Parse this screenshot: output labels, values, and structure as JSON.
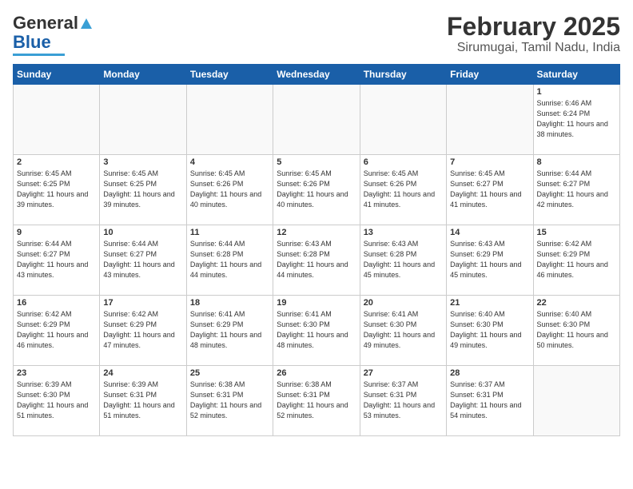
{
  "header": {
    "logo_line1": "General",
    "logo_line2": "Blue",
    "title": "February 2025",
    "subtitle": "Sirumugai, Tamil Nadu, India"
  },
  "weekdays": [
    "Sunday",
    "Monday",
    "Tuesday",
    "Wednesday",
    "Thursday",
    "Friday",
    "Saturday"
  ],
  "weeks": [
    [
      {
        "day": "",
        "info": ""
      },
      {
        "day": "",
        "info": ""
      },
      {
        "day": "",
        "info": ""
      },
      {
        "day": "",
        "info": ""
      },
      {
        "day": "",
        "info": ""
      },
      {
        "day": "",
        "info": ""
      },
      {
        "day": "1",
        "info": "Sunrise: 6:46 AM\nSunset: 6:24 PM\nDaylight: 11 hours\nand 38 minutes."
      }
    ],
    [
      {
        "day": "2",
        "info": "Sunrise: 6:45 AM\nSunset: 6:25 PM\nDaylight: 11 hours\nand 39 minutes."
      },
      {
        "day": "3",
        "info": "Sunrise: 6:45 AM\nSunset: 6:25 PM\nDaylight: 11 hours\nand 39 minutes."
      },
      {
        "day": "4",
        "info": "Sunrise: 6:45 AM\nSunset: 6:26 PM\nDaylight: 11 hours\nand 40 minutes."
      },
      {
        "day": "5",
        "info": "Sunrise: 6:45 AM\nSunset: 6:26 PM\nDaylight: 11 hours\nand 40 minutes."
      },
      {
        "day": "6",
        "info": "Sunrise: 6:45 AM\nSunset: 6:26 PM\nDaylight: 11 hours\nand 41 minutes."
      },
      {
        "day": "7",
        "info": "Sunrise: 6:45 AM\nSunset: 6:27 PM\nDaylight: 11 hours\nand 41 minutes."
      },
      {
        "day": "8",
        "info": "Sunrise: 6:44 AM\nSunset: 6:27 PM\nDaylight: 11 hours\nand 42 minutes."
      }
    ],
    [
      {
        "day": "9",
        "info": "Sunrise: 6:44 AM\nSunset: 6:27 PM\nDaylight: 11 hours\nand 43 minutes."
      },
      {
        "day": "10",
        "info": "Sunrise: 6:44 AM\nSunset: 6:27 PM\nDaylight: 11 hours\nand 43 minutes."
      },
      {
        "day": "11",
        "info": "Sunrise: 6:44 AM\nSunset: 6:28 PM\nDaylight: 11 hours\nand 44 minutes."
      },
      {
        "day": "12",
        "info": "Sunrise: 6:43 AM\nSunset: 6:28 PM\nDaylight: 11 hours\nand 44 minutes."
      },
      {
        "day": "13",
        "info": "Sunrise: 6:43 AM\nSunset: 6:28 PM\nDaylight: 11 hours\nand 45 minutes."
      },
      {
        "day": "14",
        "info": "Sunrise: 6:43 AM\nSunset: 6:29 PM\nDaylight: 11 hours\nand 45 minutes."
      },
      {
        "day": "15",
        "info": "Sunrise: 6:42 AM\nSunset: 6:29 PM\nDaylight: 11 hours\nand 46 minutes."
      }
    ],
    [
      {
        "day": "16",
        "info": "Sunrise: 6:42 AM\nSunset: 6:29 PM\nDaylight: 11 hours\nand 46 minutes."
      },
      {
        "day": "17",
        "info": "Sunrise: 6:42 AM\nSunset: 6:29 PM\nDaylight: 11 hours\nand 47 minutes."
      },
      {
        "day": "18",
        "info": "Sunrise: 6:41 AM\nSunset: 6:29 PM\nDaylight: 11 hours\nand 48 minutes."
      },
      {
        "day": "19",
        "info": "Sunrise: 6:41 AM\nSunset: 6:30 PM\nDaylight: 11 hours\nand 48 minutes."
      },
      {
        "day": "20",
        "info": "Sunrise: 6:41 AM\nSunset: 6:30 PM\nDaylight: 11 hours\nand 49 minutes."
      },
      {
        "day": "21",
        "info": "Sunrise: 6:40 AM\nSunset: 6:30 PM\nDaylight: 11 hours\nand 49 minutes."
      },
      {
        "day": "22",
        "info": "Sunrise: 6:40 AM\nSunset: 6:30 PM\nDaylight: 11 hours\nand 50 minutes."
      }
    ],
    [
      {
        "day": "23",
        "info": "Sunrise: 6:39 AM\nSunset: 6:30 PM\nDaylight: 11 hours\nand 51 minutes."
      },
      {
        "day": "24",
        "info": "Sunrise: 6:39 AM\nSunset: 6:31 PM\nDaylight: 11 hours\nand 51 minutes."
      },
      {
        "day": "25",
        "info": "Sunrise: 6:38 AM\nSunset: 6:31 PM\nDaylight: 11 hours\nand 52 minutes."
      },
      {
        "day": "26",
        "info": "Sunrise: 6:38 AM\nSunset: 6:31 PM\nDaylight: 11 hours\nand 52 minutes."
      },
      {
        "day": "27",
        "info": "Sunrise: 6:37 AM\nSunset: 6:31 PM\nDaylight: 11 hours\nand 53 minutes."
      },
      {
        "day": "28",
        "info": "Sunrise: 6:37 AM\nSunset: 6:31 PM\nDaylight: 11 hours\nand 54 minutes."
      },
      {
        "day": "",
        "info": ""
      }
    ]
  ]
}
